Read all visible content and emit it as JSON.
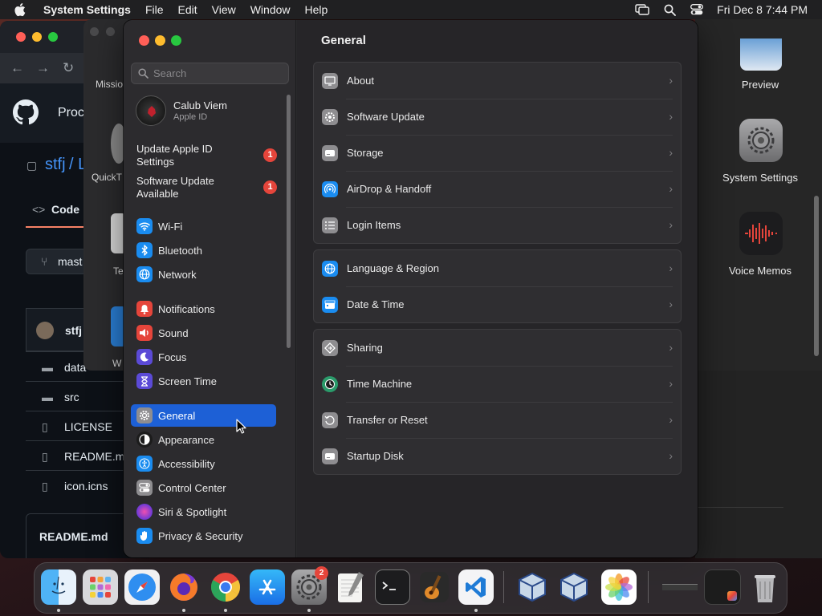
{
  "menubar": {
    "app_name": "System Settings",
    "menus": [
      "File",
      "Edit",
      "View",
      "Window",
      "Help"
    ],
    "clock": "Fri Dec 8  7:44 PM"
  },
  "background_browser": {
    "nav_heading": "Proc",
    "breadcrumb_owner": "stfj",
    "breadcrumb_sep": "/ L",
    "code_tab": "Code",
    "branch": "mast",
    "commit_user": "stfj",
    "files": [
      "data",
      "src",
      "LICENSE",
      "README.m",
      "icon.icns"
    ],
    "readme_title": "README.md"
  },
  "background_middle": {
    "labels": [
      "Missio",
      "QuickT",
      "Te",
      "W"
    ]
  },
  "background_finder": {
    "apps": [
      "Preview",
      "System Settings",
      "Voice Memos"
    ]
  },
  "settings": {
    "window_title": "General",
    "search_placeholder": "Search",
    "account": {
      "name": "Calub Viem",
      "subtitle": "Apple ID"
    },
    "notices": [
      {
        "label": "Update Apple ID Settings",
        "badge": "1"
      },
      {
        "label": "Software Update Available",
        "badge": "1"
      }
    ],
    "sidebar_items": [
      {
        "label": "Wi-Fi",
        "icon": "wifi-icon",
        "color": "#1a8cf0"
      },
      {
        "label": "Bluetooth",
        "icon": "bluetooth-icon",
        "color": "#1a8cf0"
      },
      {
        "label": "Network",
        "icon": "globe-icon",
        "color": "#1a8cf0"
      },
      {
        "label": "Notifications",
        "icon": "bell-icon",
        "color": "#e5453b"
      },
      {
        "label": "Sound",
        "icon": "speaker-icon",
        "color": "#e5453b"
      },
      {
        "label": "Focus",
        "icon": "moon-icon",
        "color": "#5b4ad6"
      },
      {
        "label": "Screen Time",
        "icon": "hourglass-icon",
        "color": "#5b4ad6"
      },
      {
        "label": "General",
        "icon": "gear-icon",
        "color": "#8e8d90",
        "selected": true
      },
      {
        "label": "Appearance",
        "icon": "appearance-icon",
        "color": "#1c1c1c"
      },
      {
        "label": "Accessibility",
        "icon": "accessibility-icon",
        "color": "#1a8cf0"
      },
      {
        "label": "Control Center",
        "icon": "toggles-icon",
        "color": "#8e8d90"
      },
      {
        "label": "Siri & Spotlight",
        "icon": "siri-icon",
        "color": "#b14ad6"
      },
      {
        "label": "Privacy & Security",
        "icon": "hand-icon",
        "color": "#1a8cf0"
      }
    ],
    "groups": [
      [
        {
          "label": "About",
          "icon": "display-icon",
          "color": "#8e8d90"
        },
        {
          "label": "Software Update",
          "icon": "gear-badge-icon",
          "color": "#8e8d90"
        },
        {
          "label": "Storage",
          "icon": "drive-icon",
          "color": "#8e8d90"
        },
        {
          "label": "AirDrop & Handoff",
          "icon": "airdrop-icon",
          "color": "#1a8cf0"
        },
        {
          "label": "Login Items",
          "icon": "list-icon",
          "color": "#8e8d90"
        }
      ],
      [
        {
          "label": "Language & Region",
          "icon": "globe-icon",
          "color": "#1a8cf0"
        },
        {
          "label": "Date & Time",
          "icon": "calendar-icon",
          "color": "#1a8cf0"
        }
      ],
      [
        {
          "label": "Sharing",
          "icon": "sharing-icon",
          "color": "#8e8d90"
        },
        {
          "label": "Time Machine",
          "icon": "time-machine-icon",
          "color": "#2a9a6a"
        },
        {
          "label": "Transfer or Reset",
          "icon": "reset-icon",
          "color": "#8e8d90"
        },
        {
          "label": "Startup Disk",
          "icon": "drive-icon",
          "color": "#8e8d90"
        }
      ]
    ]
  },
  "dock": {
    "apps": [
      {
        "name": "Finder",
        "icon": "finder-icon",
        "running": true
      },
      {
        "name": "Launchpad",
        "icon": "launchpad-icon",
        "running": false
      },
      {
        "name": "Safari",
        "icon": "safari-icon",
        "running": false
      },
      {
        "name": "Firefox",
        "icon": "firefox-icon",
        "running": true
      },
      {
        "name": "Chrome",
        "icon": "chrome-icon",
        "running": true
      },
      {
        "name": "App Store",
        "icon": "app-store-icon",
        "running": false
      },
      {
        "name": "System Settings",
        "icon": "gear-icon",
        "running": true,
        "badge": "2"
      },
      {
        "name": "TextEdit",
        "icon": "textedit-icon",
        "running": false
      },
      {
        "name": "Terminal",
        "icon": "terminal-icon",
        "running": false
      },
      {
        "name": "GarageBand",
        "icon": "guitar-icon",
        "running": false
      },
      {
        "name": "VS Code",
        "icon": "vscode-icon",
        "running": true
      },
      {
        "name": "VirtualBox",
        "icon": "virtualbox-icon",
        "running": false
      },
      {
        "name": "VirtualBox VM",
        "icon": "virtualbox-icon",
        "running": false
      },
      {
        "name": "Photos",
        "icon": "photos-icon",
        "running": false
      }
    ]
  }
}
